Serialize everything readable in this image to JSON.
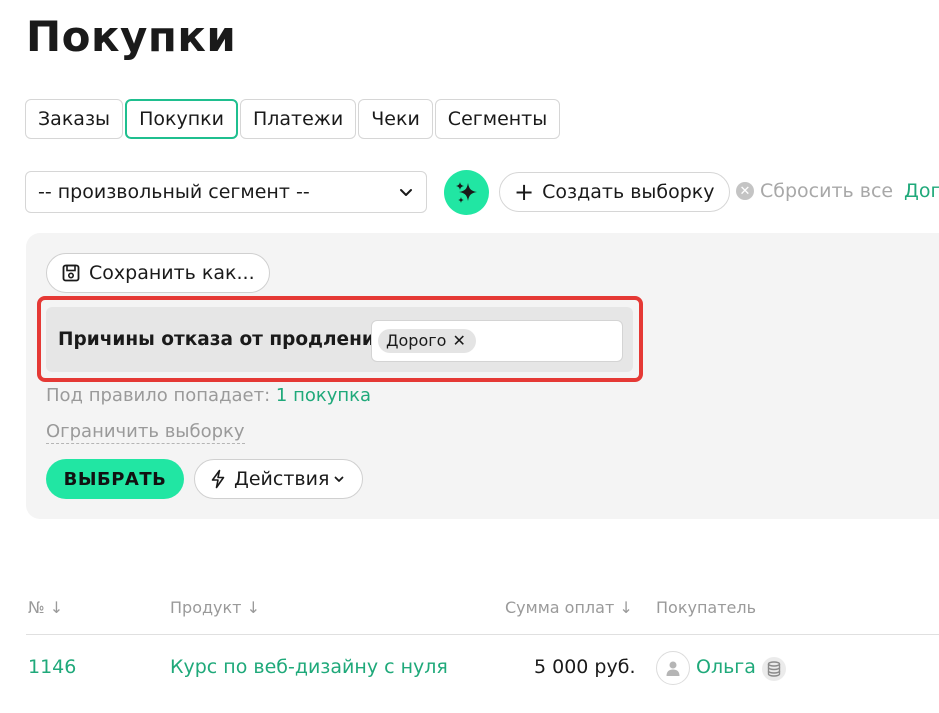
{
  "page": {
    "title": "Покупки"
  },
  "tabs": [
    {
      "label": "Заказы",
      "active": false
    },
    {
      "label": "Покупки",
      "active": true
    },
    {
      "label": "Платежи",
      "active": false
    },
    {
      "label": "Чеки",
      "active": false
    },
    {
      "label": "Сегменты",
      "active": false
    }
  ],
  "toolbar": {
    "segment_select": "-- произвольный сегмент --",
    "create_label": "Создать выборку",
    "reset_label": "Сбросить все",
    "more_label": "Доп"
  },
  "filter": {
    "save_label": "Сохранить как...",
    "rule_label": "Причины отказа от продления",
    "tag_value": "Дорого",
    "match_prefix": "Под правило попадает: ",
    "match_link": "1 покупка",
    "limit_label": "Ограничить выборку",
    "select_label": "ВЫБРАТЬ",
    "actions_label": "Действия"
  },
  "table": {
    "columns": [
      "№ ↓",
      "Продукт ↓",
      "Сумма оплат ↓",
      "Покупатель"
    ],
    "rows": [
      {
        "number": "1146",
        "product": "Курс по веб-дизайну с нуля",
        "amount": "5 000 руб.",
        "buyer": "Ольга"
      }
    ]
  },
  "colors": {
    "accent": "#21e6a3",
    "link": "#1fa97a",
    "highlight": "#e53935"
  }
}
